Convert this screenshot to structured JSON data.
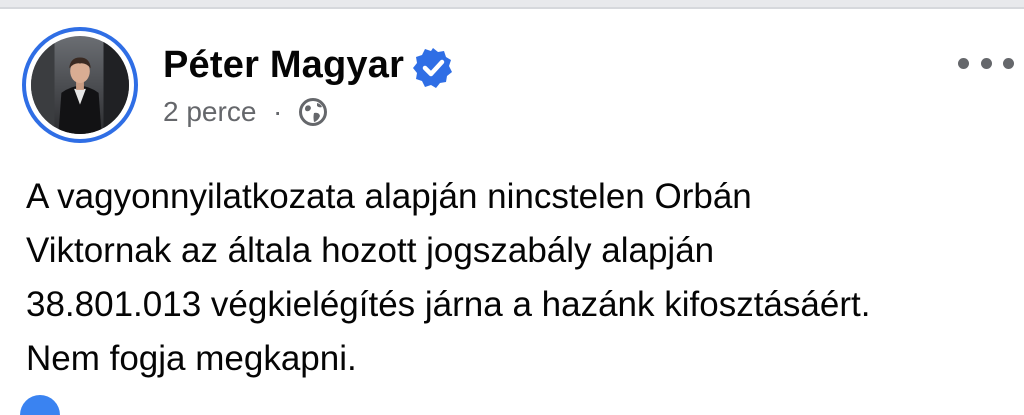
{
  "post": {
    "author": "Péter Magyar",
    "time": "2 perce",
    "separator": "·",
    "privacy_icon": "globe-icon",
    "verified_icon": "verified-badge-icon",
    "more_icon": "more-options-icon",
    "text_lines": [
      "A vagyonnyilatkozata alapján nincstelen Orbán",
      "Viktornak az általa hozott jogszabály alapján",
      "38.801.013 végkielégítés járna a hazánk kifosztásáért.",
      "Nem fogja megkapni."
    ]
  },
  "colors": {
    "accent": "#2f6ee5",
    "meta_text": "#65676b",
    "body_text": "#050505"
  }
}
